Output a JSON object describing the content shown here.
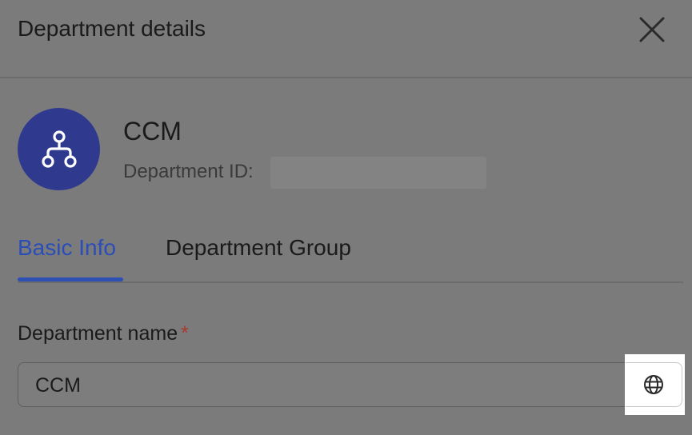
{
  "dialog": {
    "title": "Department details",
    "close_icon": "close-icon"
  },
  "department": {
    "name": "CCM",
    "id_label": "Department ID:",
    "avatar_icon": "org-structure-icon",
    "avatar_color": "#2f3a8f"
  },
  "tabs": [
    {
      "label": "Basic Info",
      "active": true
    },
    {
      "label": "Department Group",
      "active": false
    }
  ],
  "form": {
    "name_field": {
      "label": "Department name",
      "required_mark": "*",
      "value": "CCM",
      "language_icon": "globe-icon"
    }
  },
  "colors": {
    "accent": "#2e4fb3",
    "required": "#a83a2e",
    "overlay": "#7b7b7b"
  }
}
